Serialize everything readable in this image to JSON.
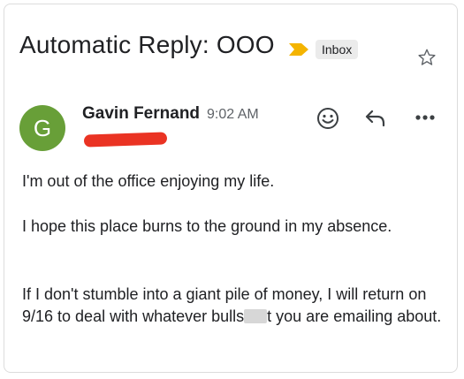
{
  "email": {
    "subject": "Automatic Reply: OOO",
    "label": "Inbox",
    "avatar_letter": "G",
    "sender_name": "Gavin Fernand",
    "time": "9:02 AM",
    "paragraphs": {
      "p1": "I'm out of the office enjoying my life.",
      "p2": "I hope this place burns to the ground in my absence.",
      "p3_before": "If I don't stumble into a giant pile of money, I will return on 9/16 to deal with whatever bulls",
      "p3_after": "t you are emailing about."
    }
  },
  "colors": {
    "avatar": "#689f38",
    "importance": "#f4b400",
    "redaction": "#ea3323"
  },
  "icons": [
    "importance-marker-icon",
    "star-icon",
    "emoji-reaction-icon",
    "reply-icon",
    "more-options-icon"
  ]
}
